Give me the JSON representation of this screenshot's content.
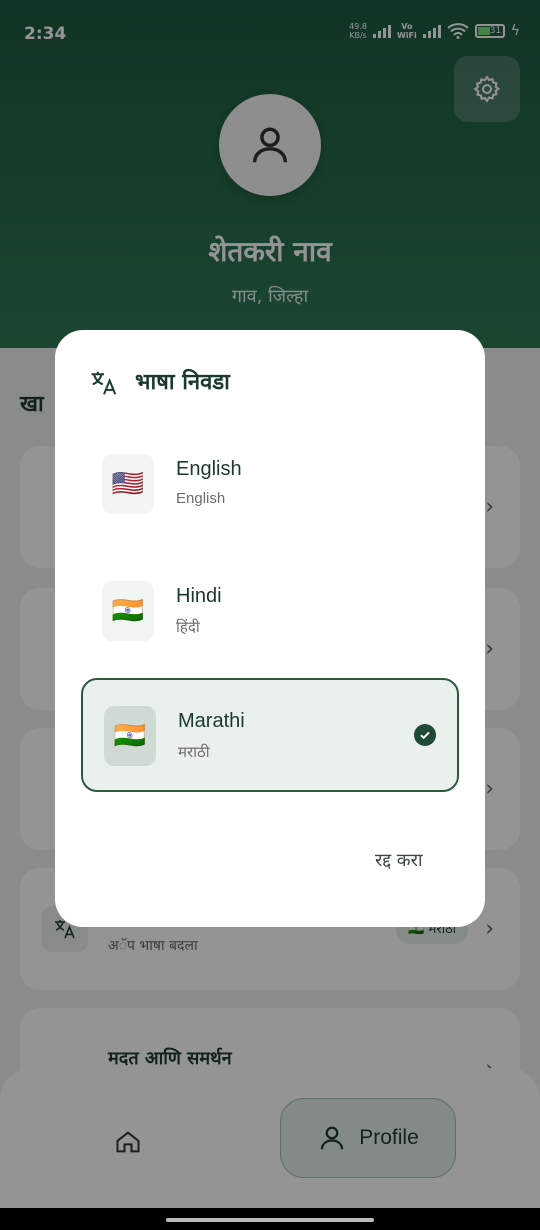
{
  "status_bar": {
    "time": "2:34",
    "speed": "49.8\nKB/s",
    "volte": "Vo\nWiFi",
    "battery": "31"
  },
  "profile": {
    "name": "शेतकरी नाव",
    "location": "गाव, जिल्हा"
  },
  "section": {
    "title": "खा"
  },
  "language_card": {
    "subtitle": "अॅप भाषा बदला",
    "chip": "🇮🇳 मराठी"
  },
  "help_card": {
    "title": "मदत आणि समर्थन"
  },
  "bottom_nav": {
    "profile_label": "Profile"
  },
  "dialog": {
    "title": "भाषा निवडा",
    "options": [
      {
        "name": "English",
        "native": "English",
        "flag": "🇺🇸",
        "selected": false
      },
      {
        "name": "Hindi",
        "native": "हिंदी",
        "flag": "🇮🇳",
        "selected": false
      },
      {
        "name": "Marathi",
        "native": "मराठी",
        "flag": "🇮🇳",
        "selected": true
      }
    ],
    "cancel_label": "रद्द करा"
  },
  "colors": {
    "primary": "#1f5a3e",
    "accent": "#2c5a41",
    "selected_bg": "#eaf0ec"
  },
  "icons": [
    "gear-icon",
    "person-icon",
    "translate-icon",
    "check-icon",
    "home-icon",
    "chevron-right-icon"
  ]
}
